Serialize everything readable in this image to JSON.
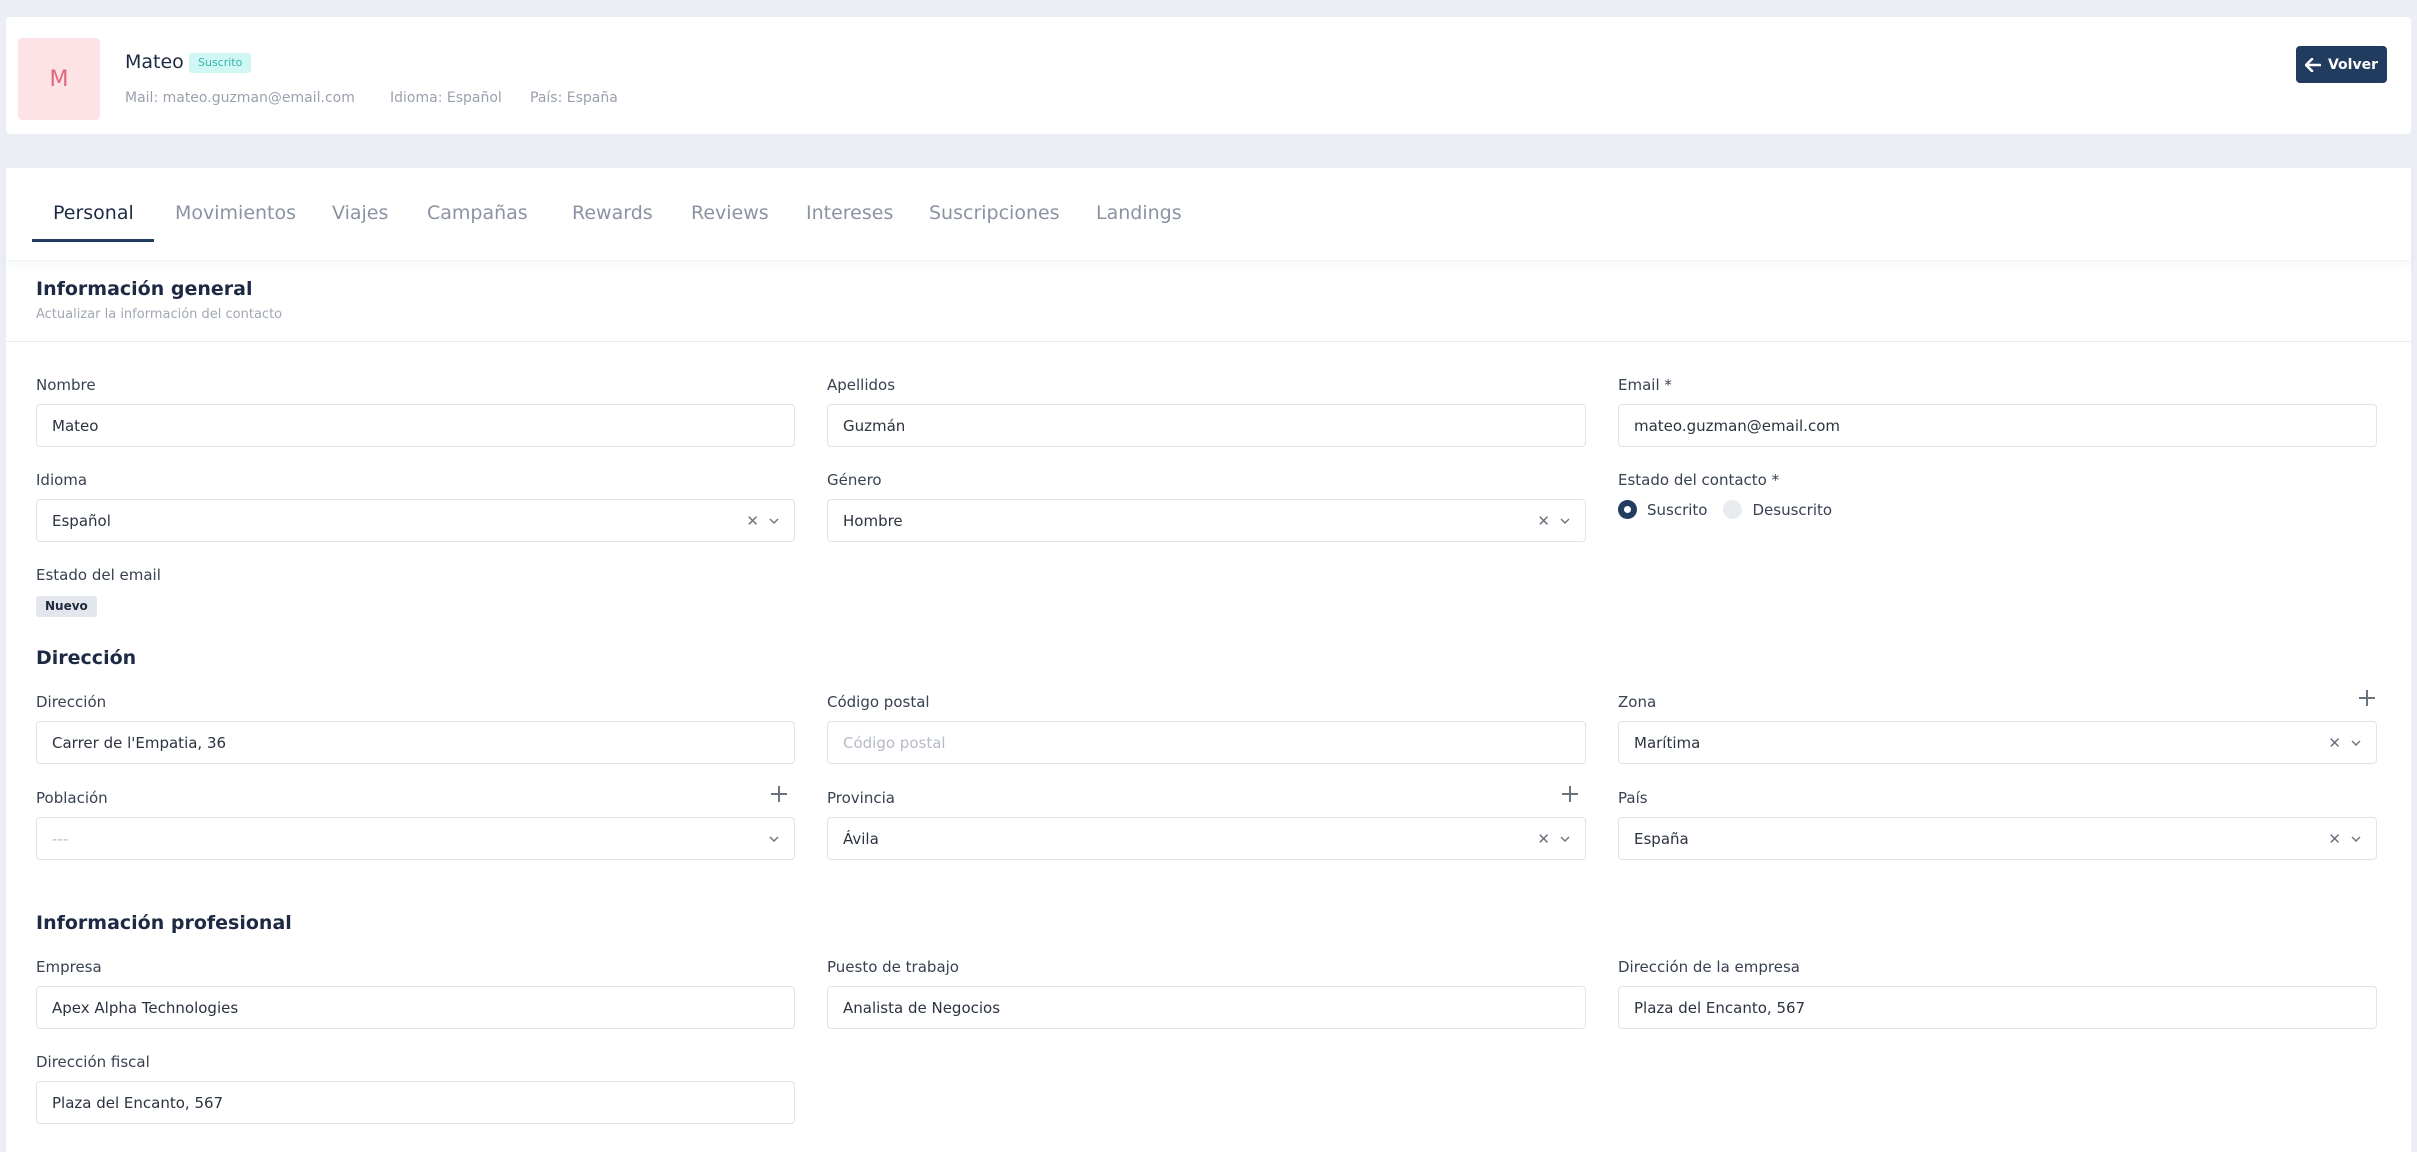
{
  "header": {
    "avatar_initial": "M",
    "name": "Mateo",
    "status_badge": "Suscrito",
    "mail": "Mail: mateo.guzman@email.com",
    "language": "Idioma: Español",
    "country": "País: España",
    "back_button": "Volver"
  },
  "tabs": [
    "Personal",
    "Movimientos",
    "Viajes",
    "Campañas",
    "Rewards",
    "Reviews",
    "Intereses",
    "Suscripciones",
    "Landings"
  ],
  "general": {
    "title": "Información general",
    "subtitle": "Actualizar la información del contacto",
    "nombre": {
      "label": "Nombre",
      "value": "Mateo"
    },
    "apellidos": {
      "label": "Apellidos",
      "value": "Guzmán"
    },
    "email": {
      "label": "Email *",
      "value": "mateo.guzman@email.com"
    },
    "idioma": {
      "label": "Idioma",
      "value": "Español"
    },
    "genero": {
      "label": "Género",
      "value": "Hombre"
    },
    "estado_contacto": {
      "label": "Estado del contacto *",
      "options": [
        "Suscrito",
        "Desuscrito"
      ],
      "selected": "Suscrito"
    },
    "estado_email": {
      "label": "Estado del email",
      "badge": "Nuevo"
    }
  },
  "direccion": {
    "title": "Dirección",
    "direccion": {
      "label": "Dirección",
      "value": "Carrer de l'Empatia, 36"
    },
    "codigo_postal": {
      "label": "Código postal",
      "placeholder": "Código postal"
    },
    "zona": {
      "label": "Zona",
      "value": "Marítima"
    },
    "poblacion": {
      "label": "Población",
      "placeholder": "---"
    },
    "provincia": {
      "label": "Provincia",
      "value": "Ávila"
    },
    "pais": {
      "label": "País",
      "value": "España"
    }
  },
  "profesional": {
    "title": "Información profesional",
    "empresa": {
      "label": "Empresa",
      "value": "Apex Alpha Technologies"
    },
    "puesto": {
      "label": "Puesto de trabajo",
      "value": "Analista de Negocios"
    },
    "direccion_empresa": {
      "label": "Dirección de la empresa",
      "value": "Plaza del Encanto, 567"
    },
    "direccion_fiscal": {
      "label": "Dirección fiscal",
      "value": "Plaza del Encanto, 567"
    }
  },
  "colors": {
    "primary": "#213c5f",
    "subscribed_badge_bg": "#d1f7f4",
    "subscribed_badge_text": "#32b6ad",
    "avatar_bg": "#fde2e6",
    "avatar_text": "#e0677d",
    "page_bg": "#eceef6"
  },
  "icons": {
    "back": "arrow-left-icon",
    "clear": "close-icon",
    "dropdown": "chevron-down-icon",
    "add": "plus-icon"
  }
}
